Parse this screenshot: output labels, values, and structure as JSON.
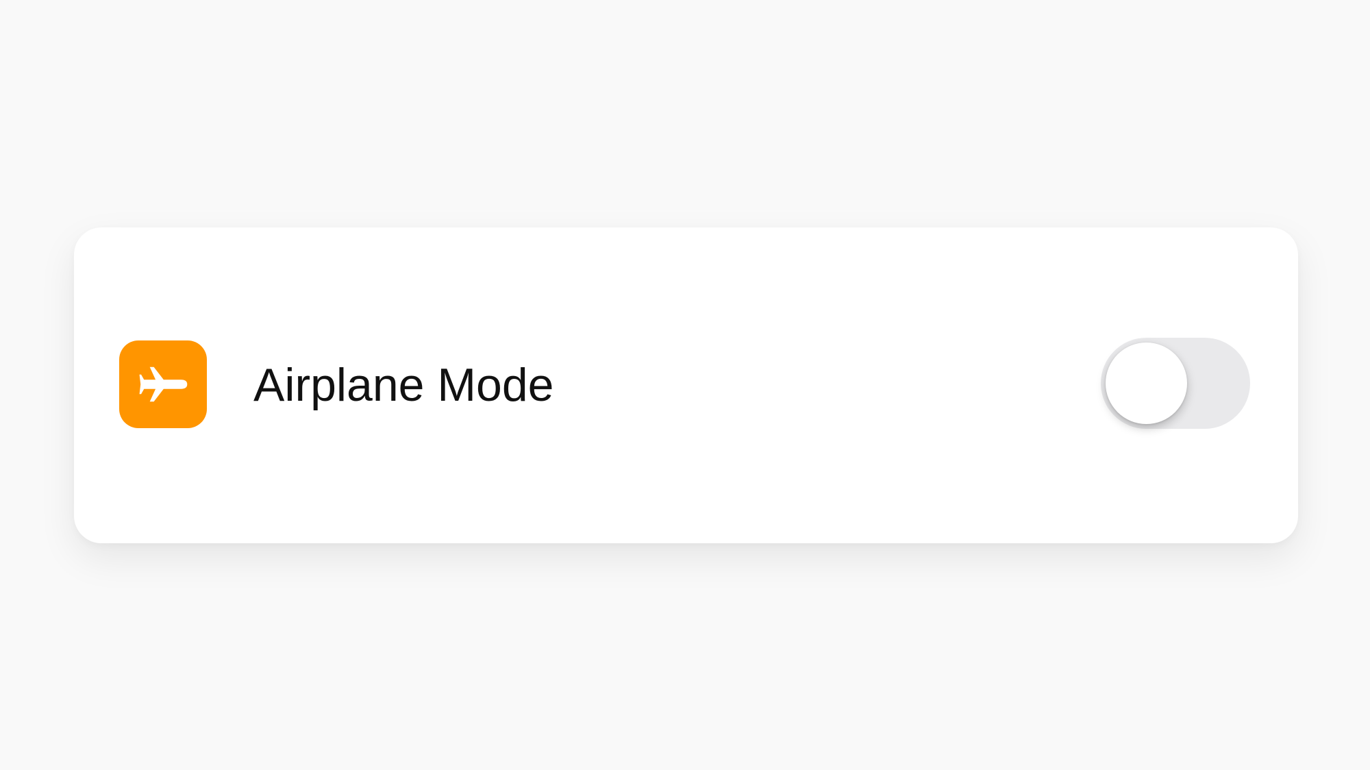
{
  "settings_row": {
    "icon": "airplane-icon",
    "icon_background": "#ff9500",
    "icon_color": "#ffffff",
    "label": "Airplane Mode",
    "toggle": {
      "on": false,
      "track_off_color": "#e9e9eb",
      "thumb_color": "#ffffff"
    }
  }
}
